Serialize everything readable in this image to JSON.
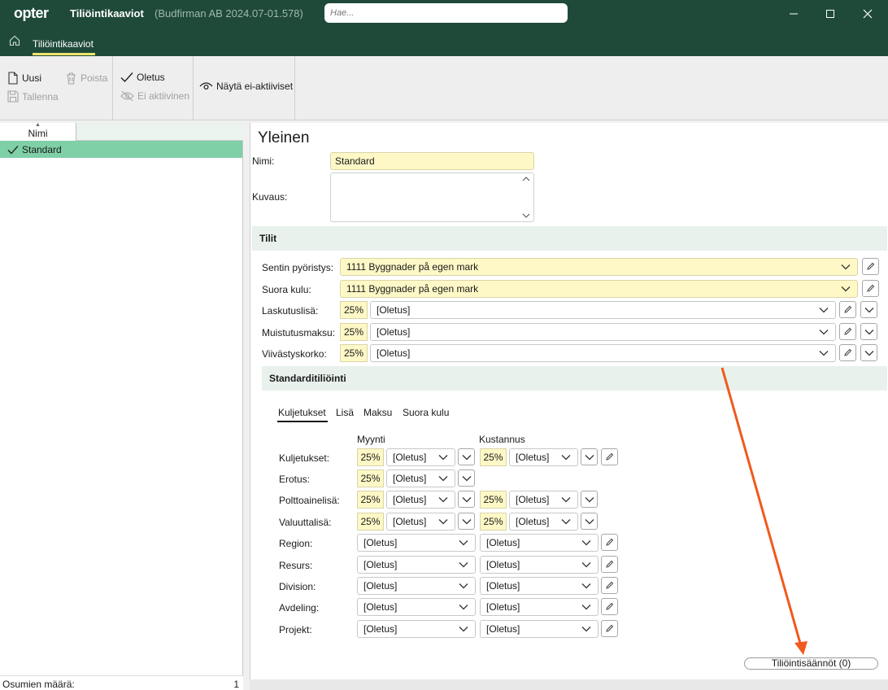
{
  "window": {
    "logo": "opter",
    "title": "Tiliöintikaaviot",
    "subtitle": "(Budfirman AB 2024.07-01.578)",
    "search_placeholder": "Hae..."
  },
  "tabs": {
    "active": "Tiliöintikaaviot"
  },
  "ribbon": {
    "new": "Uusi",
    "delete": "Poista",
    "save": "Tallenna",
    "default": "Oletus",
    "inactive": "Ei aktiivinen",
    "show_inactive": "Näytä ei-aktiiviset"
  },
  "list": {
    "column": "Nimi",
    "rows": [
      "Standard"
    ],
    "hits_label": "Osumien määrä:",
    "hits_count": "1"
  },
  "general": {
    "heading": "Yleinen",
    "name_label": "Nimi:",
    "name_value": "Standard",
    "desc_label": "Kuvaus:"
  },
  "accounts": {
    "heading": "Tilit",
    "rows": [
      {
        "label": "Sentin pyöristys:",
        "value": "1111 Byggnader på egen mark"
      },
      {
        "label": "Suora kulu:",
        "value": "1111 Byggnader på egen mark"
      },
      {
        "label": "Laskutuslisä:",
        "pct": "25%",
        "value": "[Oletus]"
      },
      {
        "label": "Muistutusmaksu:",
        "pct": "25%",
        "value": "[Oletus]"
      },
      {
        "label": "Viivästyskorko:",
        "pct": "25%",
        "value": "[Oletus]"
      }
    ]
  },
  "standard": {
    "heading": "Standarditiliöinti",
    "tabs": [
      "Kuljetukset",
      "Lisä",
      "Maksu",
      "Suora kulu"
    ],
    "col_sales": "Myynti",
    "col_cost": "Kustannus",
    "pct_rows": [
      {
        "label": "Kuljetukset:",
        "s_pct": "25%",
        "s_val": "[Oletus]",
        "c_pct": "25%",
        "c_val": "[Oletus]"
      },
      {
        "label": "Erotus:",
        "s_pct": "25%",
        "s_val": "[Oletus]"
      },
      {
        "label": "Polttoainelisä:",
        "s_pct": "25%",
        "s_val": "[Oletus]",
        "c_pct": "25%",
        "c_val": "[Oletus]"
      },
      {
        "label": "Valuuttalisä:",
        "s_pct": "25%",
        "s_val": "[Oletus]",
        "c_pct": "25%",
        "c_val": "[Oletus]"
      }
    ],
    "dim_rows": [
      {
        "label": "Region:",
        "s_val": "[Oletus]",
        "c_val": "[Oletus]"
      },
      {
        "label": "Resurs:",
        "s_val": "[Oletus]",
        "c_val": "[Oletus]"
      },
      {
        "label": "Division:",
        "s_val": "[Oletus]",
        "c_val": "[Oletus]"
      },
      {
        "label": "Avdeling:",
        "s_val": "[Oletus]",
        "c_val": "[Oletus]"
      },
      {
        "label": "Projekt:",
        "s_val": "[Oletus]",
        "c_val": "[Oletus]"
      }
    ],
    "rules_button": "Tiliöintisäännöt (0)"
  },
  "colors": {
    "titlebar": "#1f4a3a",
    "selected_row": "#7fcfa7",
    "input_yellow": "#fdf8c6",
    "annotation_arrow": "#f05a1e"
  }
}
